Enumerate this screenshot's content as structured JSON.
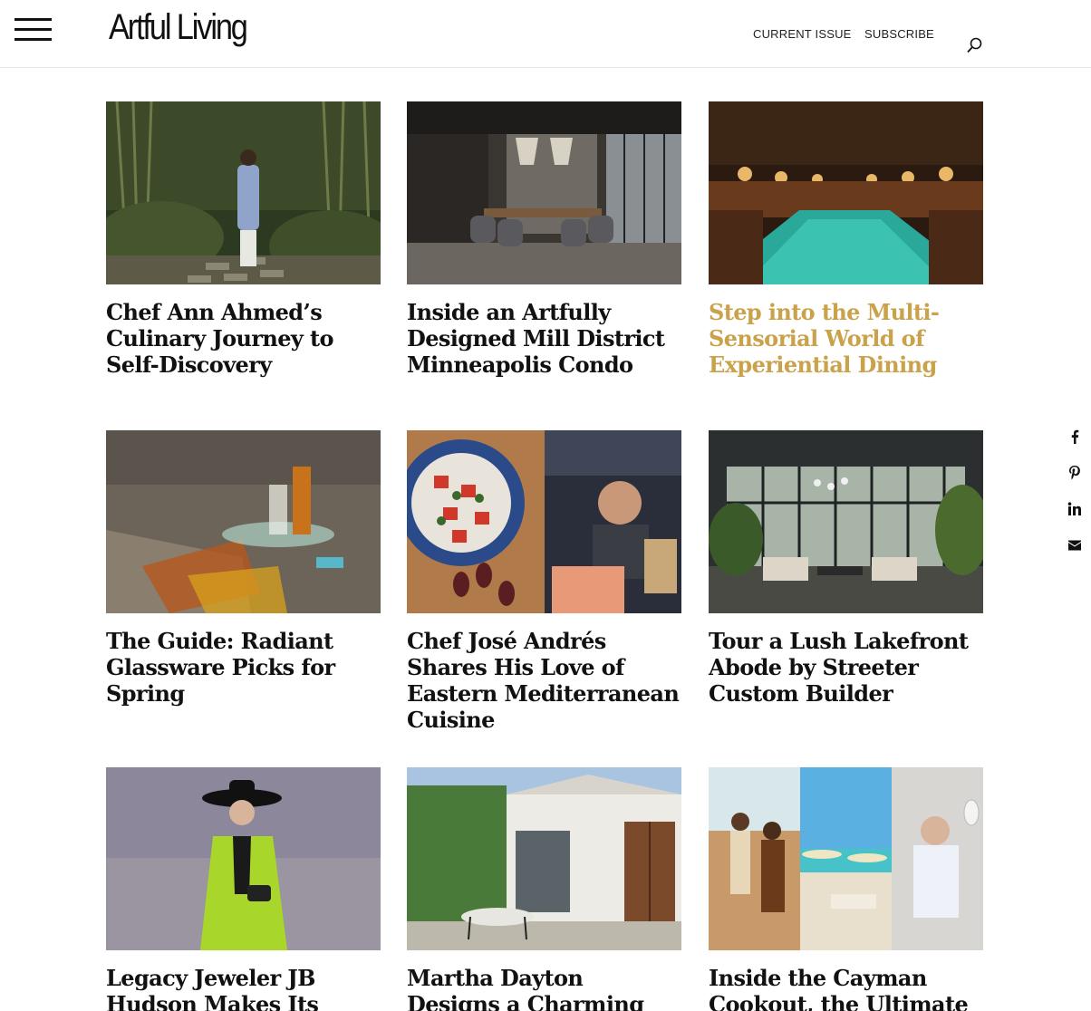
{
  "header": {
    "logo": "Artful Living",
    "nav": {
      "current_issue": "CURRENT ISSUE",
      "subscribe": "SUBSCRIBE"
    }
  },
  "articles": [
    {
      "title": "Chef Ann Ahmed’s Culinary Journey to Self-Discovery",
      "image": "chef-in-garden"
    },
    {
      "title": "Inside an Artfully Designed Mill District Minneapolis Condo",
      "image": "condo-dining-room"
    },
    {
      "title": "Step into the Multi-Sensorial World of Experiential Dining",
      "image": "indoor-pool-restaurant",
      "highlight_color": "#c9a24a"
    },
    {
      "title": "The Guide: Radiant Glassware Picks for Spring",
      "image": "glass-side-table"
    },
    {
      "title": "Chef José Andrés Shares His Love of Eastern Mediterranean Cuisine",
      "image": "salad-and-chef-at-market"
    },
    {
      "title": "Tour a Lush Lakefront Abode by Streeter Custom Builder",
      "image": "sunroom-with-plants"
    },
    {
      "title": "Legacy Jeweler JB Hudson Makes Its",
      "image": "woman-in-green-coat"
    },
    {
      "title": "Martha Dayton Designs a Charming Los",
      "image": "courtyard-with-door"
    },
    {
      "title": "Inside the Cayman Cookout, the Ultimate",
      "image": "cayman-collage"
    }
  ],
  "social": [
    "facebook-icon",
    "pinterest-icon",
    "linkedin-icon",
    "email-icon"
  ]
}
